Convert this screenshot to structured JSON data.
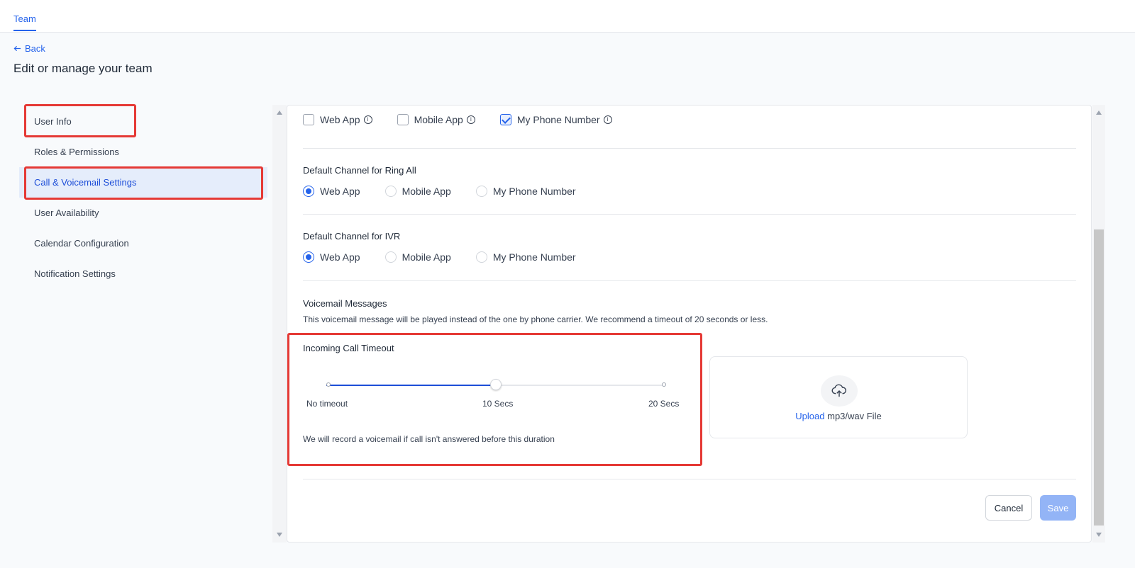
{
  "topbar": {
    "tab_label": "Team"
  },
  "header": {
    "back_label": "Back",
    "title": "Edit or manage your team"
  },
  "sidebar": {
    "items": [
      {
        "label": "User Info"
      },
      {
        "label": "Roles & Permissions"
      },
      {
        "label": "Call & Voicemail Settings",
        "active": true
      },
      {
        "label": "User Availability"
      },
      {
        "label": "Calendar Configuration"
      },
      {
        "label": "Notification Settings"
      }
    ]
  },
  "ring_channels": {
    "options": [
      {
        "label": "Web App",
        "checked": false
      },
      {
        "label": "Mobile App",
        "checked": false
      },
      {
        "label": "My Phone Number",
        "checked": true
      }
    ],
    "info_glyph": "i"
  },
  "ring_all": {
    "title": "Default Channel for Ring All",
    "options": [
      "Web App",
      "Mobile App",
      "My Phone Number"
    ],
    "selected": "Web App"
  },
  "ivr": {
    "title": "Default Channel for IVR",
    "options": [
      "Web App",
      "Mobile App",
      "My Phone Number"
    ],
    "selected": "Web App"
  },
  "voicemail": {
    "title": "Voicemail Messages",
    "description": "This voicemail message will be played instead of the one by phone carrier. We recommend a timeout of 20 seconds or less."
  },
  "timeout": {
    "title": "Incoming Call Timeout",
    "ticks": [
      "No timeout",
      "10 Secs",
      "20 Secs"
    ],
    "value_fraction": 0.5,
    "note": "We will record a voicemail if call isn't answered before this duration"
  },
  "upload": {
    "link_label": "Upload",
    "rest_label": " mp3/wav File",
    "icon": "cloud-upload-icon"
  },
  "actions": {
    "cancel_label": "Cancel",
    "save_label": "Save"
  },
  "colors": {
    "accent": "#2563eb",
    "highlight": "#e53935",
    "save_disabled": "#93b4f6"
  }
}
